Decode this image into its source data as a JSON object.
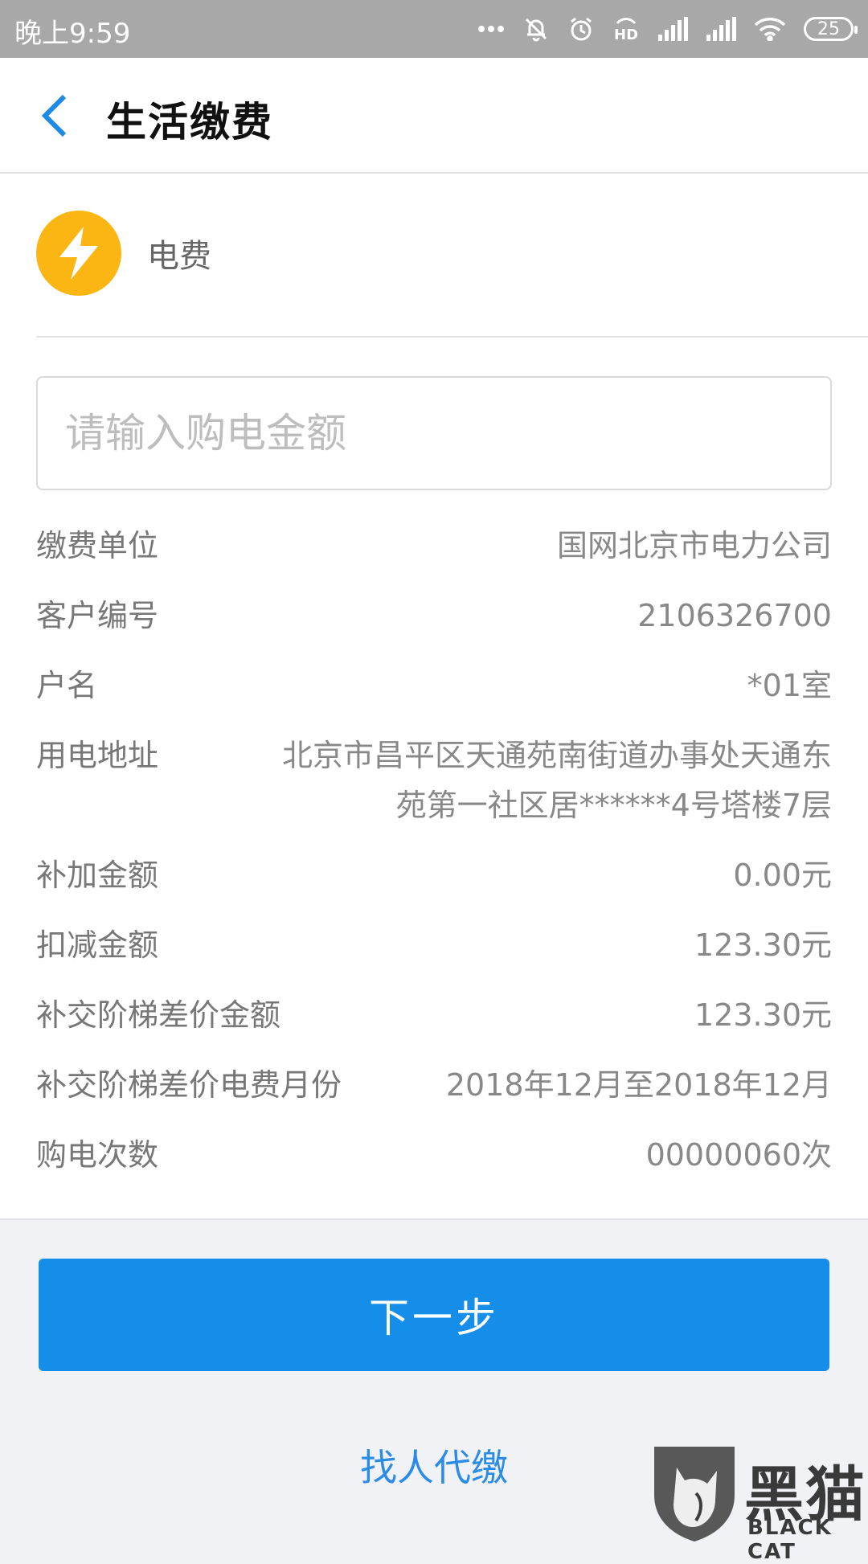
{
  "status_bar": {
    "time": "晚上9:59",
    "battery": "25"
  },
  "header": {
    "title": "生活缴费"
  },
  "service": {
    "name": "电费"
  },
  "amount": {
    "placeholder": "请输入购电金额",
    "value": ""
  },
  "info": [
    {
      "label": "缴费单位",
      "value": "国网北京市电力公司"
    },
    {
      "label": "客户编号",
      "value": "2106326700"
    },
    {
      "label": "户名",
      "value": "*01室"
    },
    {
      "label": "用电地址",
      "value": "北京市昌平区天通苑南街道办事处天通东苑第一社区居******4号塔楼7层"
    },
    {
      "label": "补加金额",
      "value": "0.00元"
    },
    {
      "label": "扣减金额",
      "value": "123.30元"
    },
    {
      "label": "补交阶梯差价金额",
      "value": "123.30元"
    },
    {
      "label": "补交阶梯差价电费月份",
      "value": "2018年12月至2018年12月"
    },
    {
      "label": "购电次数",
      "value": "00000060次"
    }
  ],
  "actions": {
    "next_label": "下一步",
    "proxy_label": "找人代缴"
  },
  "watermark": {
    "text": "黑猫",
    "sub": "BLACK CAT"
  },
  "colors": {
    "primary": "#148ee8",
    "link": "#2b8ce5",
    "service_icon": "#fbb614",
    "status_bar": "#a8a8a8"
  }
}
